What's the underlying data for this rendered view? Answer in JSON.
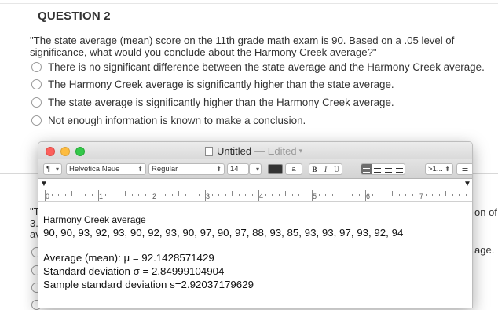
{
  "question": {
    "title": "QUESTION 2",
    "text": "\"The state average (mean) score on the 11th grade math exam is 90. Based on a .05 level of significance, what would you conclude about the Harmony Creek average?\"",
    "options": [
      "There is no significant difference between the state average and the Harmony Creek average.",
      "The Harmony Creek average is significantly higher than the state average.",
      "The state average is significantly higher than the Harmony Creek average.",
      "Not enough information is known to make a conclusion."
    ]
  },
  "background": {
    "left_frag_1": "\"T",
    "left_frag_2": "3.",
    "left_frag_3": "av",
    "right_frag_1": "on of",
    "right_frag_2": "age."
  },
  "window": {
    "doc_title": "Untitled",
    "edited_label": "— Edited",
    "toolbar": {
      "paragraph_style": "¶",
      "font_family": "Helvetica Neue",
      "font_style": "Regular",
      "font_size": "14",
      "text_color_label": "a",
      "bold": "B",
      "italic": "I",
      "underline": "U",
      "spacing": ">1...",
      "list": "☰"
    },
    "ruler_labels": [
      "0",
      "1",
      "2",
      "3",
      "4",
      "5",
      "6",
      "7"
    ]
  },
  "document": {
    "heading": "Harmony Creek average",
    "data_line": "90, 90, 93, 92, 93, 90, 92, 93, 90, 97, 90, 97, 88, 93, 85, 93, 93, 97, 93, 92, 94",
    "mean": "Average (mean): μ = 92.1428571429",
    "std": "Standard deviation σ = 2.84999104904",
    "sample_std": "Sample standard deviation s=2.92037179629"
  }
}
